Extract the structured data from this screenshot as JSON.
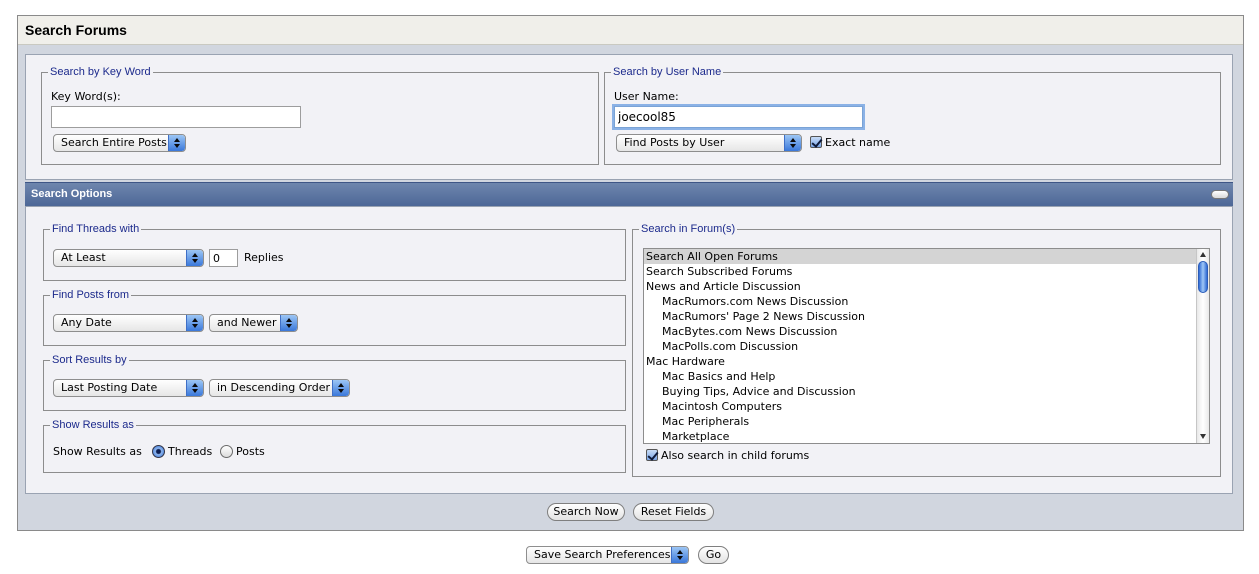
{
  "header": {
    "title": "Search Forums"
  },
  "keyword_search": {
    "legend": "Search by Key Word",
    "field_label": "Key Word(s):",
    "value": "",
    "scope_select": "Search Entire Posts"
  },
  "user_search": {
    "legend": "Search by User Name",
    "field_label": "User Name:",
    "value": "joecool85",
    "mode_select": "Find Posts by User",
    "exact_name_label": "Exact name",
    "exact_name_checked": true
  },
  "options": {
    "title": "Search Options",
    "find_threads": {
      "legend": "Find Threads with",
      "comparison_select": "At Least",
      "replies_value": "0",
      "replies_label": "Replies"
    },
    "find_posts": {
      "legend": "Find Posts from",
      "date_select": "Any Date",
      "direction_select": "and Newer"
    },
    "sort": {
      "legend": "Sort Results by",
      "field_select": "Last Posting Date",
      "order_select": "in Descending Order"
    },
    "show_as": {
      "legend": "Show Results as",
      "label": "Show Results as",
      "threads_label": "Threads",
      "posts_label": "Posts",
      "selected": "Threads"
    },
    "forums": {
      "legend": "Search in Forum(s)",
      "items": [
        {
          "label": "Search All Open Forums",
          "indent": 0,
          "selected": true
        },
        {
          "label": "Search Subscribed Forums",
          "indent": 0
        },
        {
          "label": "News and Article Discussion",
          "indent": 0
        },
        {
          "label": "MacRumors.com News Discussion",
          "indent": 1
        },
        {
          "label": "MacRumors' Page 2 News Discussion",
          "indent": 1
        },
        {
          "label": "MacBytes.com News Discussion",
          "indent": 1
        },
        {
          "label": "MacPolls.com Discussion",
          "indent": 1
        },
        {
          "label": "Mac Hardware",
          "indent": 0
        },
        {
          "label": "Mac Basics and Help",
          "indent": 1
        },
        {
          "label": "Buying Tips, Advice and Discussion",
          "indent": 1
        },
        {
          "label": "Macintosh Computers",
          "indent": 1
        },
        {
          "label": "Mac Peripherals",
          "indent": 1
        },
        {
          "label": "Marketplace",
          "indent": 1
        }
      ],
      "child_forums_label": "Also search in child forums",
      "child_forums_checked": true
    }
  },
  "actions": {
    "search_now": "Search Now",
    "reset_fields": "Reset Fields"
  },
  "preferences": {
    "select": "Save Search Preferences",
    "go": "Go"
  },
  "colors": {
    "header_blue": "#4d6797",
    "legend_text": "#1c2a8c",
    "panel_bg": "#f2f2f6",
    "outer_bg": "#d1d6df"
  }
}
